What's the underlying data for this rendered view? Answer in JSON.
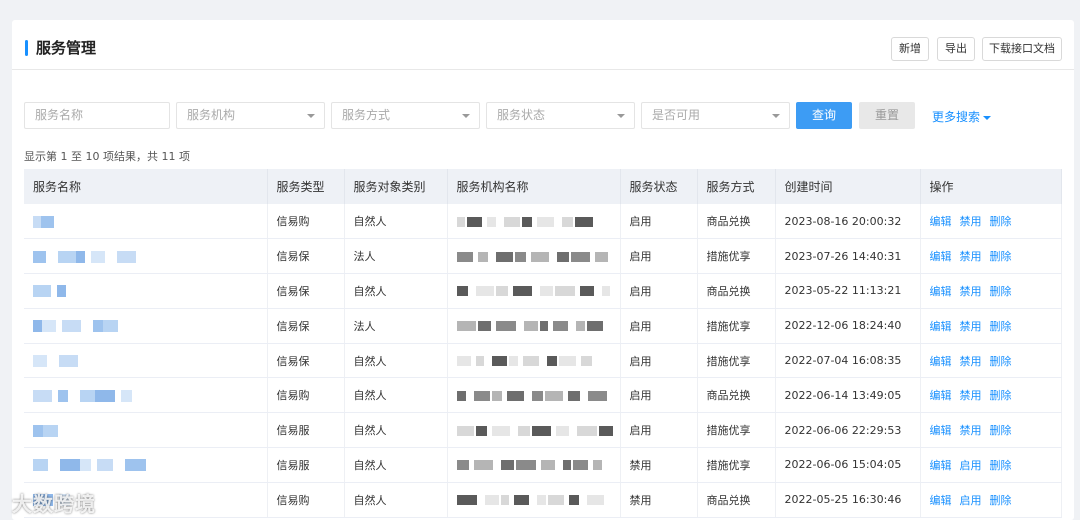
{
  "header": {
    "title": "服务管理",
    "buttons": [
      "新增",
      "导出",
      "下载接口文档"
    ]
  },
  "filters": {
    "service_name_placeholder": "服务名称",
    "org_placeholder": "服务机构",
    "mode_placeholder": "服务方式",
    "status_placeholder": "服务状态",
    "available_placeholder": "是否可用",
    "query_label": "查询",
    "reset_label": "重置",
    "more_label": "更多搜索"
  },
  "summary": "显示第 1 至 10 项结果，共 11 项",
  "table": {
    "columns": [
      "服务名称",
      "服务类型",
      "服务对象类别",
      "服务机构名称",
      "服务状态",
      "服务方式",
      "创建时间",
      "操作"
    ],
    "rows": [
      {
        "type": "信易购",
        "target": "自然人",
        "status": "启用",
        "mode": "商品兑换",
        "created": "2023-08-16 20:00:32",
        "op1": "编辑",
        "op2": "禁用",
        "op3": "删除"
      },
      {
        "type": "信易保",
        "target": "法人",
        "status": "启用",
        "mode": "措施优享",
        "created": "2023-07-26 14:40:31",
        "op1": "编辑",
        "op2": "禁用",
        "op3": "删除"
      },
      {
        "type": "信易保",
        "target": "自然人",
        "status": "启用",
        "mode": "商品兑换",
        "created": "2023-05-22 11:13:21",
        "op1": "编辑",
        "op2": "禁用",
        "op3": "删除"
      },
      {
        "type": "信易保",
        "target": "法人",
        "status": "启用",
        "mode": "措施优享",
        "created": "2022-12-06 18:24:40",
        "op1": "编辑",
        "op2": "禁用",
        "op3": "删除"
      },
      {
        "type": "信易保",
        "target": "自然人",
        "status": "启用",
        "mode": "措施优享",
        "created": "2022-07-04 16:08:35",
        "op1": "编辑",
        "op2": "禁用",
        "op3": "删除"
      },
      {
        "type": "信易购",
        "target": "自然人",
        "status": "启用",
        "mode": "商品兑换",
        "created": "2022-06-14 13:49:05",
        "op1": "编辑",
        "op2": "禁用",
        "op3": "删除"
      },
      {
        "type": "信易服",
        "target": "自然人",
        "status": "启用",
        "mode": "措施优享",
        "created": "2022-06-06 22:29:53",
        "op1": "编辑",
        "op2": "禁用",
        "op3": "删除"
      },
      {
        "type": "信易服",
        "target": "自然人",
        "status": "禁用",
        "mode": "措施优享",
        "created": "2022-06-06 15:04:05",
        "op1": "编辑",
        "op2": "启用",
        "op3": "删除"
      },
      {
        "type": "信易购",
        "target": "自然人",
        "status": "禁用",
        "mode": "商品兑换",
        "created": "2022-05-25 16:30:46",
        "op1": "编辑",
        "op2": "启用",
        "op3": "删除"
      }
    ]
  },
  "watermark": "大数跨境",
  "colors": {
    "accent": "#1890ff",
    "query_button": "#3d9cf4"
  }
}
